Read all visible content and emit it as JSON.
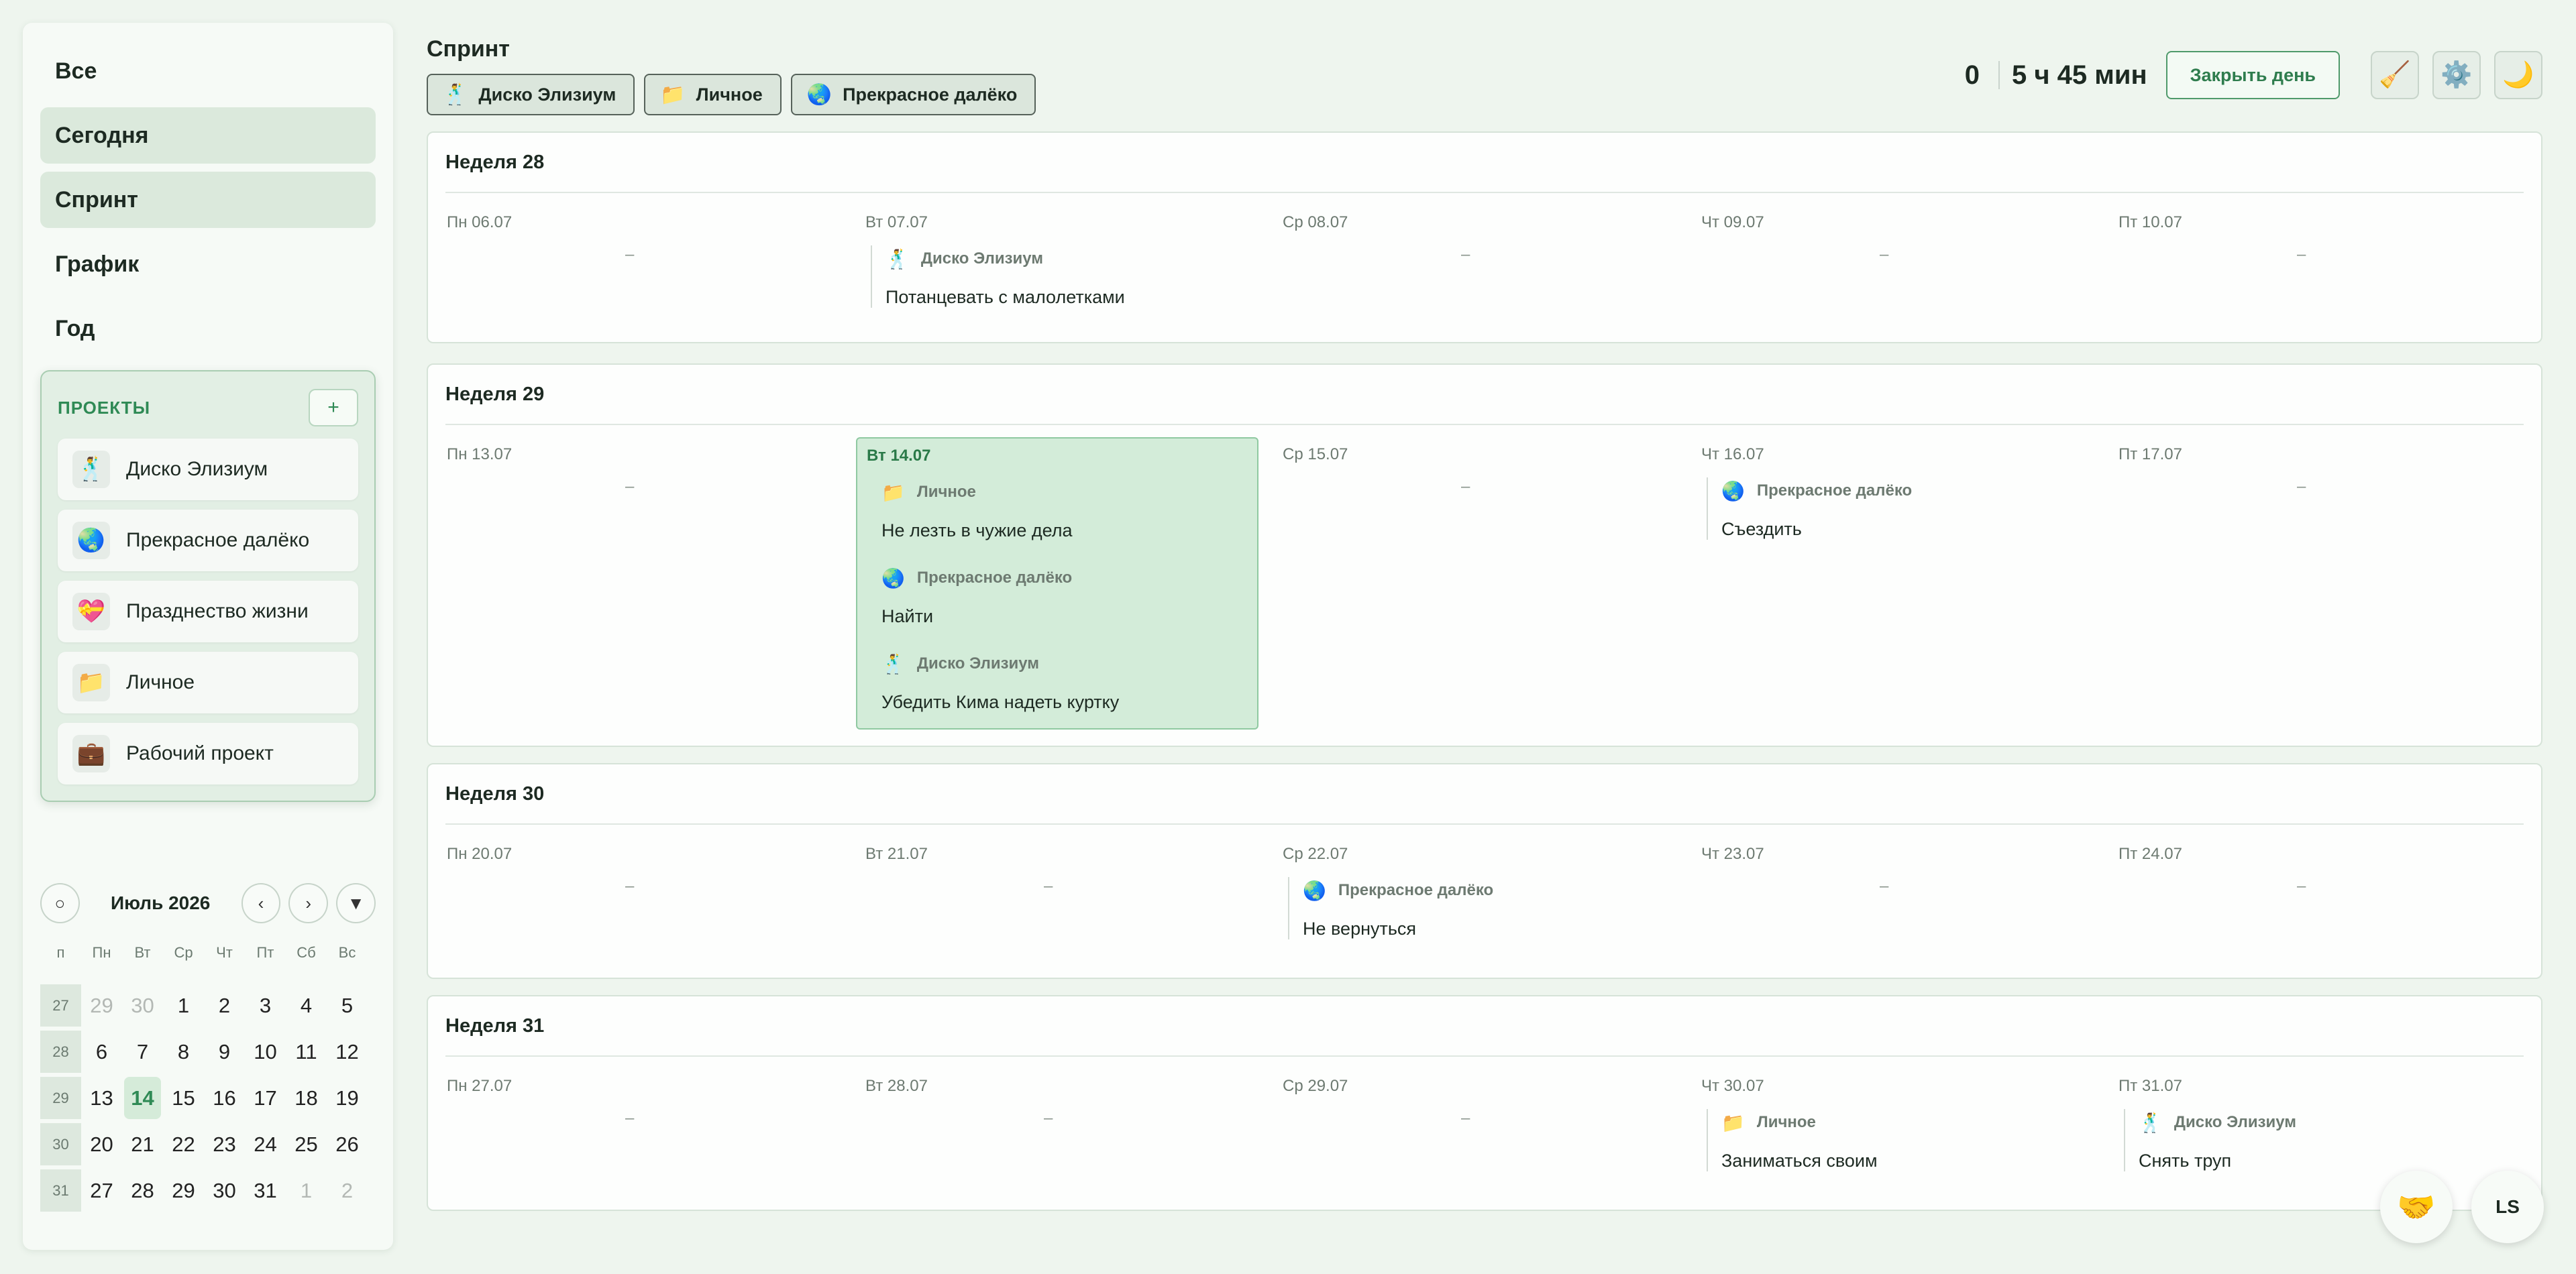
{
  "nav": {
    "items": [
      {
        "label": "Все",
        "active": false
      },
      {
        "label": "Сегодня",
        "active": true
      },
      {
        "label": "Спринт",
        "active": true
      },
      {
        "label": "График",
        "active": false
      },
      {
        "label": "Год",
        "active": false
      }
    ]
  },
  "projects": {
    "title": "ПРОЕКТЫ",
    "add_label": "+",
    "items": [
      {
        "name": "Диско Элизиум",
        "icon": "🕺"
      },
      {
        "name": "Прекрасное далёко",
        "icon": "🌏"
      },
      {
        "name": "Празднество жизни",
        "icon": "💝"
      },
      {
        "name": "Личное",
        "icon": "📁"
      },
      {
        "name": "Рабочий проект",
        "icon": "💼"
      }
    ]
  },
  "calendar": {
    "today_btn": "○",
    "title": "Июль 2026",
    "prev": "‹",
    "next": "›",
    "expand": "▼",
    "headers": [
      "п",
      "Пн",
      "Вт",
      "Ср",
      "Чт",
      "Пт",
      "Сб",
      "Вс"
    ],
    "weeks": [
      {
        "num": "27",
        "days": [
          {
            "d": "29",
            "muted": true
          },
          {
            "d": "30",
            "muted": true
          },
          {
            "d": "1"
          },
          {
            "d": "2"
          },
          {
            "d": "3"
          },
          {
            "d": "4"
          },
          {
            "d": "5"
          }
        ]
      },
      {
        "num": "28",
        "days": [
          {
            "d": "6"
          },
          {
            "d": "7"
          },
          {
            "d": "8"
          },
          {
            "d": "9"
          },
          {
            "d": "10"
          },
          {
            "d": "11"
          },
          {
            "d": "12"
          }
        ]
      },
      {
        "num": "29",
        "days": [
          {
            "d": "13"
          },
          {
            "d": "14",
            "today": true
          },
          {
            "d": "15"
          },
          {
            "d": "16"
          },
          {
            "d": "17"
          },
          {
            "d": "18"
          },
          {
            "d": "19"
          }
        ]
      },
      {
        "num": "30",
        "days": [
          {
            "d": "20"
          },
          {
            "d": "21"
          },
          {
            "d": "22"
          },
          {
            "d": "23"
          },
          {
            "d": "24"
          },
          {
            "d": "25"
          },
          {
            "d": "26"
          }
        ]
      },
      {
        "num": "31",
        "days": [
          {
            "d": "27"
          },
          {
            "d": "28"
          },
          {
            "d": "29"
          },
          {
            "d": "30"
          },
          {
            "d": "31"
          },
          {
            "d": "1",
            "muted": true
          },
          {
            "d": "2",
            "muted": true
          }
        ]
      }
    ]
  },
  "header": {
    "title": "Спринт",
    "filters": [
      {
        "label": "Диско Элизиум",
        "icon": "🕺"
      },
      {
        "label": "Личное",
        "icon": "📁"
      },
      {
        "label": "Прекрасное далёко",
        "icon": "🌏"
      }
    ],
    "counter": "0",
    "time": "5 ч 45 мин",
    "close_day": "Закрыть день",
    "broom_icon": "🧹",
    "gear_icon": "⚙️",
    "moon_icon": "🌙"
  },
  "weeks": [
    {
      "title": "Неделя 28",
      "days": [
        {
          "label": "Пн 06.07",
          "tasks": []
        },
        {
          "label": "Вт 07.07",
          "tasks": [
            {
              "project": "Диско Элизиум",
              "icon": "🕺",
              "title": "Потанцевать с малолетками"
            }
          ]
        },
        {
          "label": "Ср 08.07",
          "tasks": []
        },
        {
          "label": "Чт 09.07",
          "tasks": []
        },
        {
          "label": "Пт 10.07",
          "tasks": []
        }
      ]
    },
    {
      "title": "Неделя 29",
      "days": [
        {
          "label": "Пн 13.07",
          "tasks": []
        },
        {
          "label": "Вт 14.07",
          "today": true,
          "tasks": [
            {
              "project": "Личное",
              "icon": "📁",
              "title": "Не лезть в чужие дела"
            },
            {
              "project": "Прекрасное далёко",
              "icon": "🌏",
              "title": "Найти"
            },
            {
              "project": "Диско Элизиум",
              "icon": "🕺",
              "title": "Убедить Кима надеть куртку"
            }
          ]
        },
        {
          "label": "Ср 15.07",
          "tasks": []
        },
        {
          "label": "Чт 16.07",
          "tasks": [
            {
              "project": "Прекрасное далёко",
              "icon": "🌏",
              "title": "Съездить"
            }
          ]
        },
        {
          "label": "Пт 17.07",
          "tasks": []
        }
      ]
    },
    {
      "title": "Неделя 30",
      "days": [
        {
          "label": "Пн 20.07",
          "tasks": []
        },
        {
          "label": "Вт 21.07",
          "tasks": []
        },
        {
          "label": "Ср 22.07",
          "tasks": [
            {
              "project": "Прекрасное далёко",
              "icon": "🌏",
              "title": "Не вернуться"
            }
          ]
        },
        {
          "label": "Чт 23.07",
          "tasks": []
        },
        {
          "label": "Пт 24.07",
          "tasks": []
        }
      ]
    },
    {
      "title": "Неделя 31",
      "days": [
        {
          "label": "Пн 27.07",
          "tasks": []
        },
        {
          "label": "Вт 28.07",
          "tasks": []
        },
        {
          "label": "Ср 29.07",
          "tasks": []
        },
        {
          "label": "Чт 30.07",
          "tasks": [
            {
              "project": "Личное",
              "icon": "📁",
              "title": "Заниматься своим"
            }
          ]
        },
        {
          "label": "Пт 31.07",
          "tasks": [
            {
              "project": "Диско Элизиум",
              "icon": "🕺",
              "title": "Снять труп"
            }
          ]
        }
      ]
    }
  ],
  "empty_mark": "–",
  "footer": {
    "help_icon": "🤝",
    "user_initials": "LS"
  }
}
